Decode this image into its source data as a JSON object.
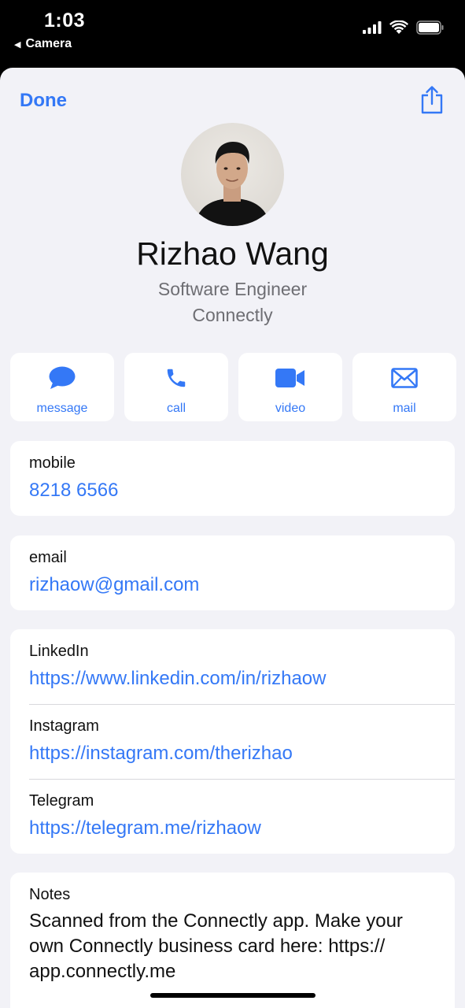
{
  "status_bar": {
    "time": "1:03",
    "back_app": "Camera",
    "icons": [
      "cellular-signal-icon",
      "wifi-icon",
      "battery-icon"
    ]
  },
  "header": {
    "done_label": "Done",
    "share_icon": "share-icon"
  },
  "contact": {
    "name": "Rizhao Wang",
    "job_title": "Software Engineer",
    "company": "Connectly"
  },
  "actions": [
    {
      "label": "message",
      "icon": "message-icon"
    },
    {
      "label": "call",
      "icon": "phone-icon"
    },
    {
      "label": "video",
      "icon": "video-icon"
    },
    {
      "label": "mail",
      "icon": "mail-icon"
    }
  ],
  "fields": {
    "mobile": {
      "label": "mobile",
      "value": "8218 6566"
    },
    "email": {
      "label": "email",
      "value": "rizhaow@gmail.com"
    },
    "links": [
      {
        "label": "LinkedIn",
        "value": "https://www.linkedin.com/in/rizhaow"
      },
      {
        "label": "Instagram",
        "value": "https://instagram.com/therizhao"
      },
      {
        "label": "Telegram",
        "value": "https://telegram.me/rizhaow"
      }
    ],
    "notes": {
      "label": "Notes",
      "line1": "Scanned from the Connectly app. Make your",
      "line2": "own Connectly business card here: https://",
      "line3": "app.connectly.me"
    }
  },
  "colors": {
    "accent": "#3478f6",
    "background": "#f2f2f7",
    "card": "#ffffff"
  }
}
